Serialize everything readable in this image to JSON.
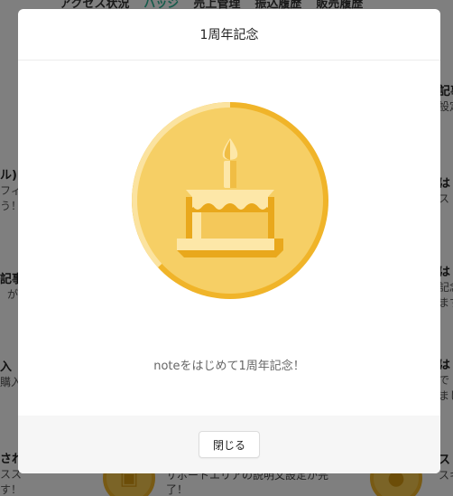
{
  "background": {
    "tabs": [
      {
        "label": "アクセス状況",
        "active": false
      },
      {
        "label": "バッジ",
        "active": true
      },
      {
        "label": "売上管理",
        "active": false
      },
      {
        "label": "振込履歴",
        "active": false
      },
      {
        "label": "販売履歴",
        "active": false
      }
    ],
    "left_fragments": [
      {
        "title": "ル)",
        "lines": [
          "フィ",
          "う！"
        ]
      },
      {
        "title": "記事",
        "lines": [
          "が"
        ]
      },
      {
        "title": "入",
        "lines": [
          "購入"
        ]
      },
      {
        "title": "され",
        "lines": [
          "スス",
          "す！"
        ]
      }
    ],
    "right_fragments": [
      {
        "title": "記事",
        "lines": [
          "設定"
        ]
      },
      {
        "title": "は",
        "lines": [
          "ス"
        ]
      },
      {
        "title": "は",
        "lines": [
          "記念",
          "ます"
        ]
      },
      {
        "title": "は",
        "lines": [
          "で",
          "まし"
        ]
      },
      {
        "title": "ス",
        "lines": [
          "スキ"
        ]
      }
    ],
    "bottom_text": [
      "サポートエリアの説明文設定が完",
      "了！"
    ]
  },
  "modal": {
    "title": "1周年記念",
    "badge_icon": "birthday-cake-icon",
    "message": "noteをはじめて1周年記念！",
    "close_label": "閉じる"
  },
  "colors": {
    "accent": "#2cb696",
    "medal_ring": "#f0b429",
    "medal_face": "#f6cf65",
    "medal_highlight": "#fbe3a0",
    "cake_dark": "#e9a81c",
    "cake_light": "#fde7a8"
  }
}
